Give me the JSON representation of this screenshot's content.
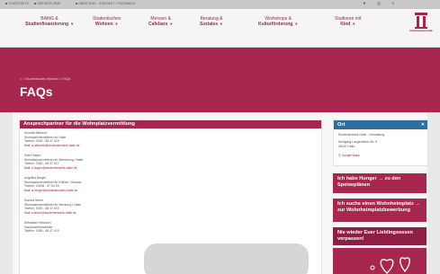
{
  "topbar": {
    "links": [
      "STARTSEITE",
      "SPEISEPLÄNE",
      "ÜBER UNS",
      "KONTAKT / FEEDBACK"
    ],
    "icons": [
      "user-icon",
      "cart-icon",
      "menu-icon"
    ]
  },
  "nav": {
    "items": [
      {
        "l1": "BAföG &",
        "l2": "Studienfinanzierung"
      },
      {
        "l1": "Studentisches",
        "l2": "Wohnen"
      },
      {
        "l1": "Mensen &",
        "l2": "Cafebars"
      },
      {
        "l1": "Beratung &",
        "l2": "Soziales"
      },
      {
        "l1": "Workshops &",
        "l2": "Kulturförderung"
      },
      {
        "l1": "Studieren mit",
        "l2": "Kind"
      }
    ],
    "logo_text": "Studentenwerk Halle"
  },
  "hero": {
    "breadcrumb": "⌂  >  Studentisches Wohnen  >  FAQs",
    "title": "FAQs"
  },
  "main": {
    "heading": "Ansprechpartner für die Wohnplatzvermittlung",
    "contacts": [
      {
        "name": "Annette Albrecht",
        "role": "Wohnplatzvermittlerin für Halle",
        "phone": "Telefon: 0345 - 68 47 415",
        "mail": "Mail: a.albrecht@studentenwerk-halle.de"
      },
      {
        "name": "Silke Hoppe",
        "role": "Wohnplatzvermittlerin für Merseburg / Halle",
        "phone": "Telefon: 0345 - 68 47 417",
        "mail": "Mail: s.hoppe@studentenwerk-halle.de"
      },
      {
        "name": "Angelika Berger",
        "role": "Wohnplatzvermittlerin für Köthen / Dessau",
        "phone": "Telefon: 03496 - 67 54 25",
        "mail": "Mail: a.berger@studentenwerk-halle.de"
      },
      {
        "name": "Sandra Sturm",
        "role": "Wohnplatzvermittlerin für Bernburg / Halle",
        "phone": "Telefon: 0345 - 68 47 415",
        "mail": "Mail: s.sturm@studentenwerk-halle.de"
      },
      {
        "name": "Sebastian Heubach",
        "role": "Hauptsachbearbeiter",
        "phone": "Telefon: 0345 - 68 47 419",
        "mail": ""
      }
    ]
  },
  "sidebar": {
    "ort": {
      "heading": "Ort",
      "lines": [
        "Studentenwerk Halle - Verwaltung",
        "Wolfgang-Langenbeck-Str. 5",
        "06120 Halle"
      ],
      "link": "Google Maps"
    },
    "cta1": "Ich habe Hunger → zu den Speiseplänen",
    "cta2": "Ich suche einen Wohnheimplatz → zur Wohnheimplatzbewerbung",
    "cta3": "Nie wieder Euer Lieblingsessen verpassen!"
  },
  "colors": {
    "accent": "#a8274e",
    "info": "#2c6e9e"
  }
}
